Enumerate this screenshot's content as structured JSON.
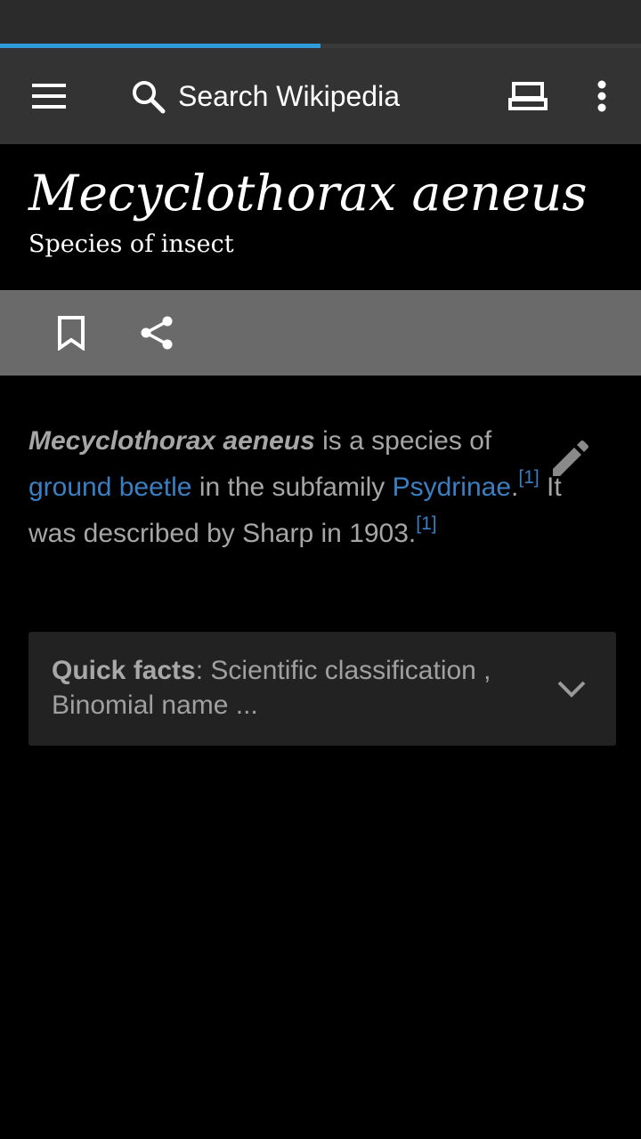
{
  "browser": {
    "load_progress_percent": 50
  },
  "toolbar": {
    "search_placeholder": "Search Wikipedia",
    "icons": [
      "menu-icon",
      "search-icon",
      "reading-list-icon",
      "more-vert-icon"
    ]
  },
  "article": {
    "title": "Mecyclothorax aeneus",
    "subtitle": "Species of insect",
    "lead": {
      "bold": "Mecyclothorax aeneus",
      "text1": " is a species of ",
      "link1": "ground beetle",
      "text2": " in the subfamily ",
      "link2": "Psydrinae",
      "text3": ".",
      "ref1": "[1]",
      "text4": " It was described by Sharp in 1903.",
      "ref2": "[1]"
    },
    "quick_facts": {
      "label": "Quick facts",
      "summary": ": Scientific classification , Binomial name ..."
    }
  },
  "actions": {
    "icons": [
      "bookmark-icon",
      "share-icon",
      "edit-pencil-icon"
    ]
  },
  "colors": {
    "progress": "#2f9bd8",
    "link": "#3a7fc1",
    "toolbar_bg": "#333333",
    "action_bar_bg": "#6a6a6a"
  }
}
